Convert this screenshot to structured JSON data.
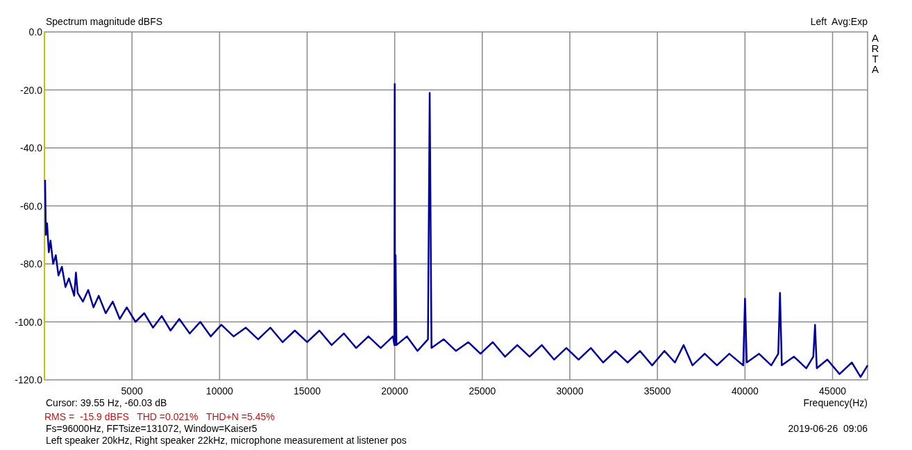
{
  "header": {
    "channel_info": "Left  Avg:Exp"
  },
  "brand": "ARTA",
  "chart_data": {
    "type": "line",
    "title": "Spectrum magnitude dBFS",
    "xlabel": "Frequency(Hz)",
    "grid": true,
    "xlim": [
      0,
      47000
    ],
    "ylim": [
      -120,
      0
    ],
    "xticks": [
      5000,
      10000,
      15000,
      20000,
      25000,
      30000,
      35000,
      40000,
      45000
    ],
    "yticks": [
      {
        "value": 0,
        "label": "0.0"
      },
      {
        "value": -20,
        "label": "-20.0"
      },
      {
        "value": -40,
        "label": "-40.0"
      },
      {
        "value": -60,
        "label": "-60.0"
      },
      {
        "value": -80,
        "label": "-80.0"
      },
      {
        "value": -100,
        "label": "-100.0"
      },
      {
        "value": -120,
        "label": "-120.0"
      }
    ],
    "x": [
      40,
      80,
      150,
      250,
      350,
      500,
      650,
      800,
      1000,
      1200,
      1400,
      1700,
      1800,
      1900,
      2200,
      2500,
      2800,
      3100,
      3500,
      3900,
      4300,
      4700,
      5200,
      5700,
      6200,
      6700,
      7200,
      7700,
      8300,
      8900,
      9500,
      10100,
      10800,
      11500,
      12200,
      12900,
      13600,
      14300,
      15000,
      15700,
      16400,
      17100,
      17800,
      18500,
      19200,
      19900,
      19980,
      20000,
      20020,
      20050,
      20100,
      20700,
      21300,
      21900,
      22000,
      22100,
      22800,
      23500,
      24200,
      24900,
      25600,
      26300,
      27000,
      27700,
      28400,
      29100,
      29800,
      30500,
      31200,
      31900,
      32600,
      33300,
      34000,
      34700,
      35400,
      36000,
      36500,
      37000,
      37700,
      38400,
      39100,
      39900,
      40000,
      40100,
      40800,
      41500,
      41900,
      42000,
      42100,
      42800,
      43500,
      43900,
      44000,
      44100,
      44700,
      45400,
      46100,
      46600,
      47000
    ],
    "series": [
      {
        "color": "#00009c",
        "values": [
          -51,
          -70,
          -66,
          -76,
          -72,
          -80,
          -77,
          -84,
          -81,
          -88,
          -85,
          -91,
          -83,
          -90,
          -93,
          -89,
          -95,
          -91,
          -97,
          -93,
          -99,
          -95,
          -100,
          -97,
          -102,
          -98,
          -103,
          -99,
          -104,
          -100,
          -105,
          -101,
          -105,
          -102,
          -106,
          -102,
          -107,
          -103,
          -107,
          -103,
          -108,
          -104,
          -109,
          -105,
          -109,
          -105,
          -108,
          -18,
          -108,
          -77,
          -108,
          -105,
          -110,
          -106,
          -21,
          -109,
          -106,
          -110,
          -107,
          -111,
          -107,
          -112,
          -108,
          -112,
          -108,
          -113,
          -109,
          -113,
          -109,
          -114,
          -110,
          -114,
          -110,
          -115,
          -110,
          -114,
          -108,
          -115,
          -111,
          -115,
          -111,
          -115,
          -92,
          -114,
          -111,
          -115,
          -111,
          -90,
          -115,
          -112,
          -116,
          -112,
          -101,
          -116,
          -113,
          -118,
          -114,
          -119,
          -115
        ]
      }
    ]
  },
  "footer": {
    "cursor": "Cursor: 39.55 Hz, -60.03 dB",
    "stats": "RMS =  -15.9 dBFS   THD =0.021%   THD+N =5.45%",
    "settings": "Fs=96000Hz, FFTsize=131072, Window=Kaiser5",
    "timestamp": "2019-06-26  09:06",
    "note": "Left speaker 20kHz, Right speaker 22kHz, microphone measurement at listener pos"
  }
}
